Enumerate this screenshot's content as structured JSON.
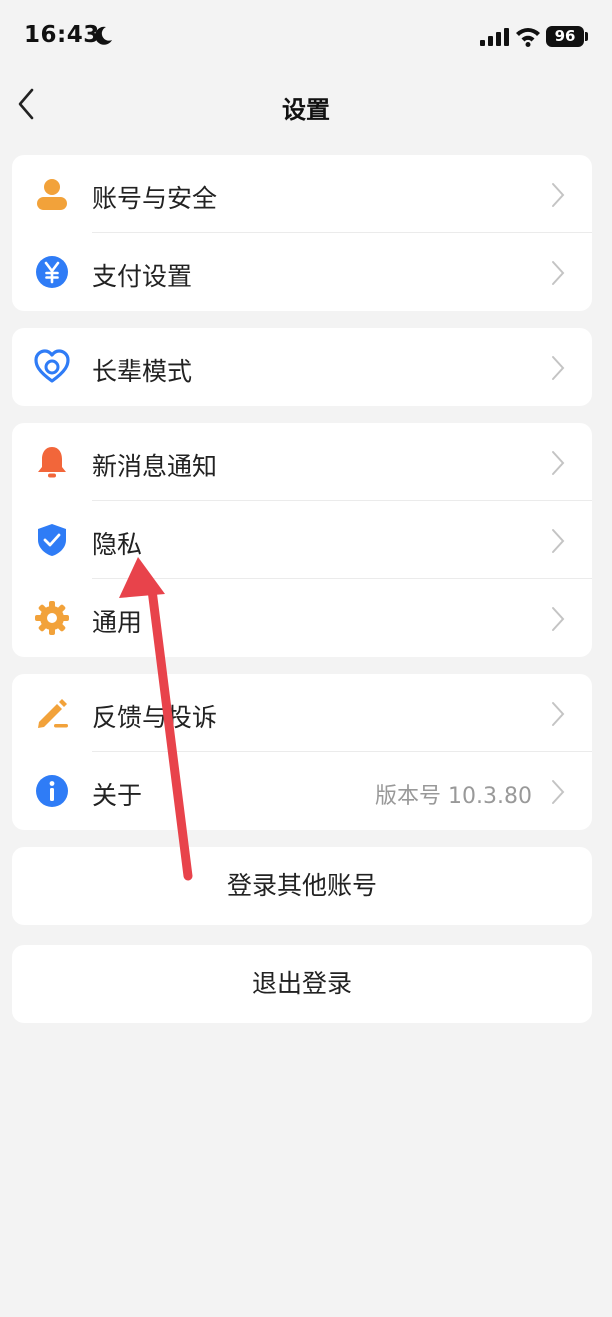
{
  "status_bar": {
    "time": "16:43",
    "battery": "96",
    "icons": [
      "moon-icon",
      "signal-icon",
      "wifi-icon",
      "battery-icon"
    ]
  },
  "nav": {
    "title": "设置",
    "back_icon": "chevron-left-icon"
  },
  "groups": [
    {
      "items": [
        {
          "label": "账号与安全",
          "icon": "user-icon",
          "color": "#f2a23a"
        },
        {
          "label": "支付设置",
          "icon": "yuan-icon",
          "color": "#2f7cf6"
        }
      ]
    },
    {
      "items": [
        {
          "label": "长辈模式",
          "icon": "heart-icon",
          "color": "#2f7cf6"
        }
      ]
    },
    {
      "items": [
        {
          "label": "新消息通知",
          "icon": "bell-icon",
          "color": "#f2663a"
        },
        {
          "label": "隐私",
          "icon": "shield-icon",
          "color": "#2f7cf6"
        },
        {
          "label": "通用",
          "icon": "gear-icon",
          "color": "#f2a23a"
        }
      ]
    },
    {
      "items": [
        {
          "label": "反馈与投诉",
          "icon": "pencil-icon",
          "color": "#f2a23a"
        },
        {
          "label": "关于",
          "icon": "info-icon",
          "color": "#2f7cf6",
          "value": "版本号 10.3.80"
        }
      ]
    }
  ],
  "actions": {
    "switch_account": "登录其他账号",
    "logout": "退出登录"
  },
  "annotation_color": "#e8434b"
}
